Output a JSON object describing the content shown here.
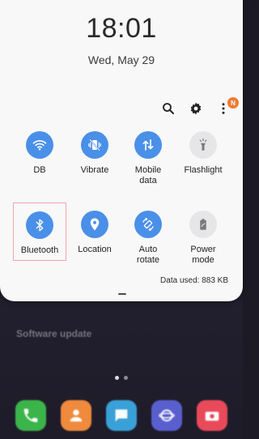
{
  "clock": {
    "time": "18:01",
    "date": "Wed, May 29"
  },
  "header_icons": {
    "search": "search-icon",
    "settings": "gear-icon",
    "more": "more-vertical-icon",
    "notification_badge": "N"
  },
  "tiles": [
    {
      "id": "wifi",
      "label": "DB",
      "state": "on",
      "icon": "wifi-icon"
    },
    {
      "id": "vibrate",
      "label": "Vibrate",
      "state": "on",
      "icon": "vibrate-icon"
    },
    {
      "id": "mobile-data",
      "label": "Mobile\ndata",
      "state": "on",
      "icon": "data-arrows-icon"
    },
    {
      "id": "flashlight",
      "label": "Flashlight",
      "state": "off",
      "icon": "flashlight-icon"
    },
    {
      "id": "bluetooth",
      "label": "Bluetooth",
      "state": "on",
      "icon": "bluetooth-icon"
    },
    {
      "id": "location",
      "label": "Location",
      "state": "on",
      "icon": "location-pin-icon"
    },
    {
      "id": "auto-rotate",
      "label": "Auto\nrotate",
      "state": "on",
      "icon": "rotate-icon"
    },
    {
      "id": "power-mode",
      "label": "Power\nmode",
      "state": "off",
      "icon": "battery-icon"
    }
  ],
  "data_usage": "Data used: 883 KB",
  "colors": {
    "accent": "#4a90e8",
    "tile_off": "#e6e6e8",
    "badge": "#f07a32",
    "highlight_border": "#f0a6a6"
  },
  "background": {
    "notification_title": "Software update",
    "dock_apps": [
      "phone-app",
      "contacts-app",
      "messages-app",
      "internet-app",
      "camera-app"
    ]
  }
}
